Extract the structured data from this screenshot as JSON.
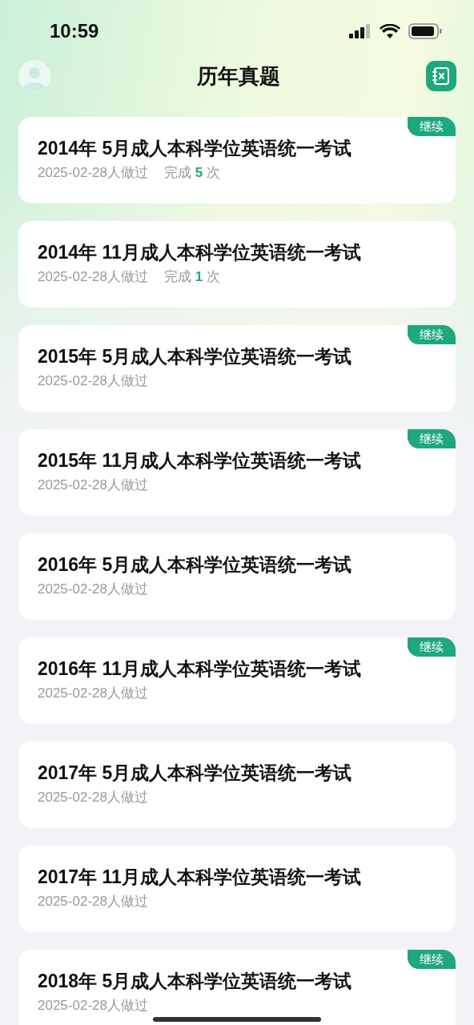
{
  "status_bar": {
    "time": "10:59"
  },
  "header": {
    "title": "历年真题"
  },
  "papers": [
    {
      "title": "2014年 5月成人本科学位英语统一考试",
      "date": "2025-02-28人做过",
      "badge": "继续",
      "completed": {
        "label": "完成",
        "count": "5",
        "unit": "次"
      }
    },
    {
      "title": "2014年 11月成人本科学位英语统一考试",
      "date": "2025-02-28人做过",
      "completed": {
        "label": "完成",
        "count": "1",
        "unit": "次"
      }
    },
    {
      "title": "2015年 5月成人本科学位英语统一考试",
      "date": "2025-02-28人做过",
      "badge": "继续"
    },
    {
      "title": "2015年 11月成人本科学位英语统一考试",
      "date": "2025-02-28人做过",
      "badge": "继续"
    },
    {
      "title": "2016年 5月成人本科学位英语统一考试",
      "date": "2025-02-28人做过"
    },
    {
      "title": "2016年 11月成人本科学位英语统一考试",
      "date": "2025-02-28人做过",
      "badge": "继续"
    },
    {
      "title": "2017年 5月成人本科学位英语统一考试",
      "date": "2025-02-28人做过"
    },
    {
      "title": "2017年 11月成人本科学位英语统一考试",
      "date": "2025-02-28人做过"
    },
    {
      "title": "2018年 5月成人本科学位英语统一考试",
      "date": "2025-02-28人做过",
      "badge": "继续"
    }
  ]
}
